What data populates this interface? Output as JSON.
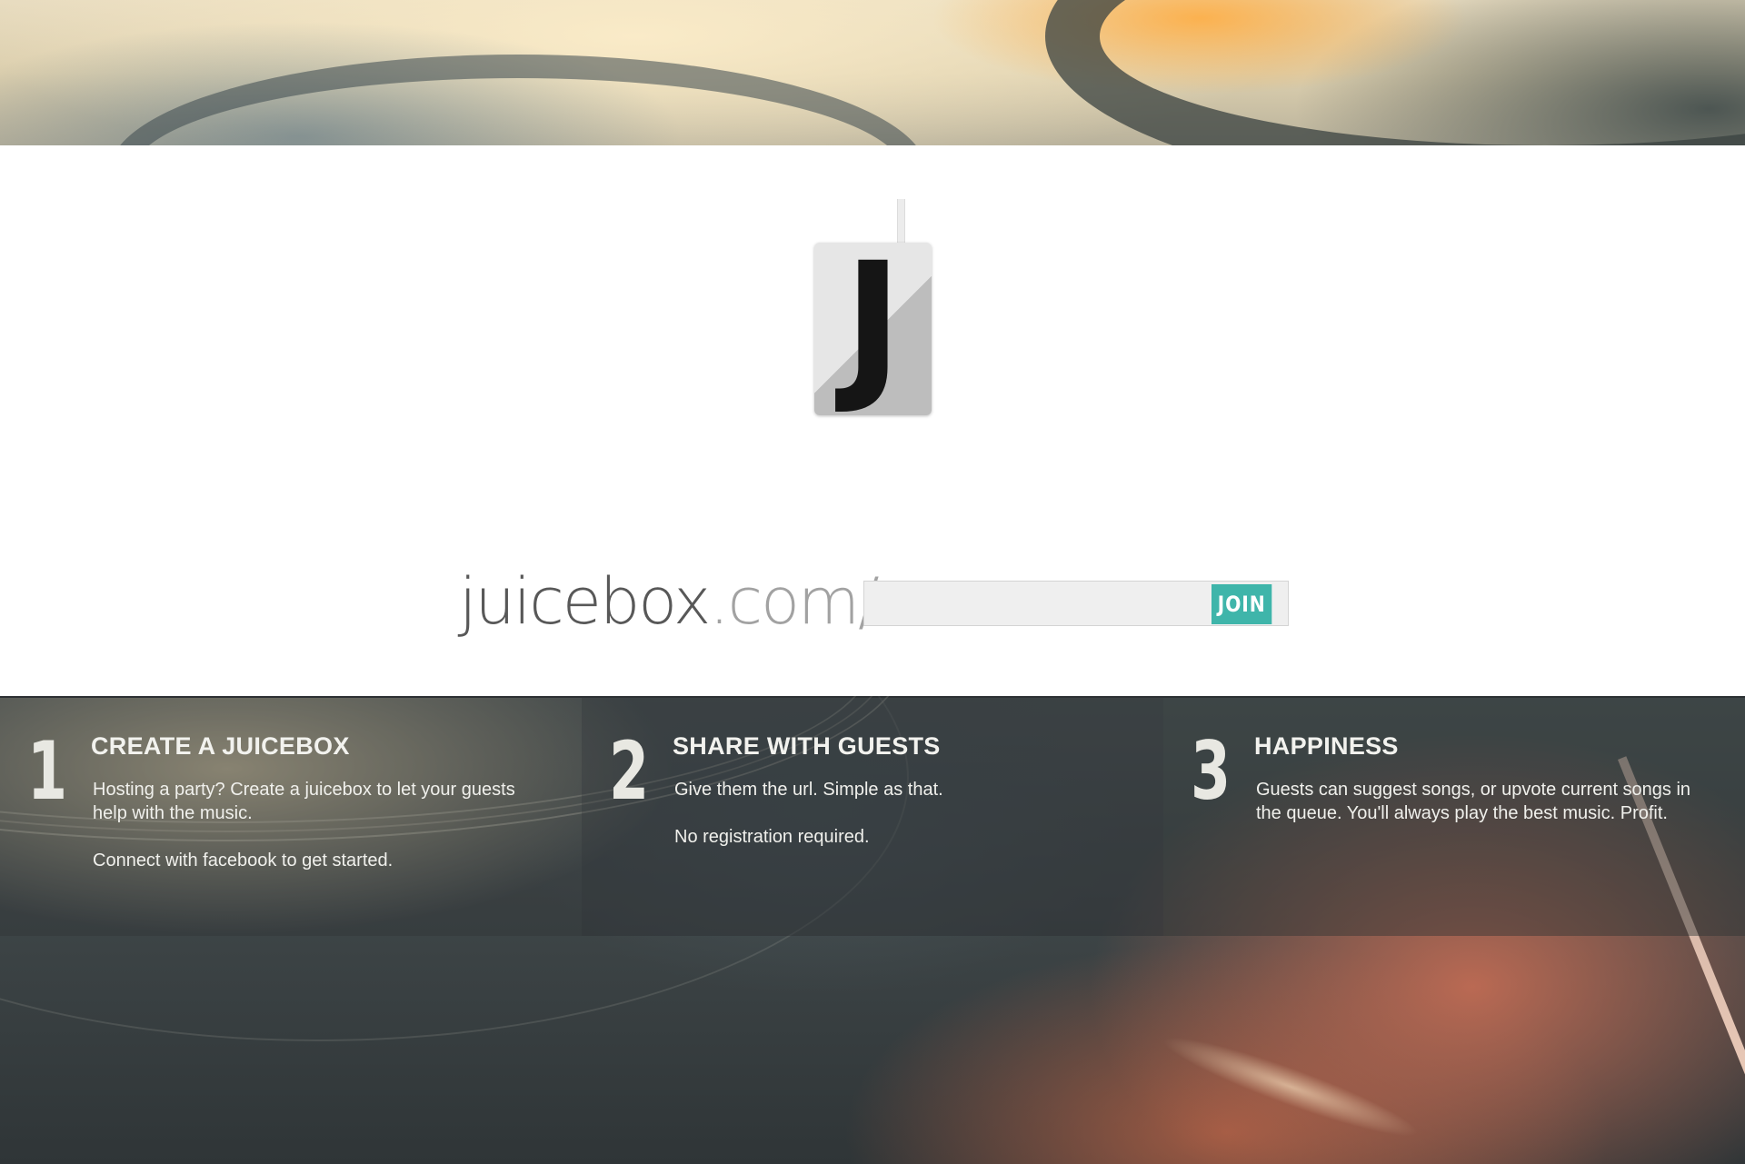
{
  "brand": {
    "logo_letter": "J",
    "domain_main": "juicebox",
    "domain_tld": ".com/"
  },
  "join": {
    "input_value": "",
    "input_placeholder": "",
    "button_label": "JOIN",
    "button_color": "#3fb5aa"
  },
  "steps": [
    {
      "number": "1",
      "title": "CREATE A JUICEBOX",
      "body": [
        "Hosting a party?  Create a juicebox to let your guests help with the music.",
        "Connect with facebook to get started."
      ]
    },
    {
      "number": "2",
      "title": "SHARE WITH GUESTS",
      "body": [
        "Give them the url.  Simple as that.",
        "No registration required."
      ]
    },
    {
      "number": "3",
      "title": "HAPPINESS",
      "body": [
        "Guests can suggest songs, or upvote current songs in the queue.  You'll always play the best music.  Profit."
      ]
    }
  ]
}
